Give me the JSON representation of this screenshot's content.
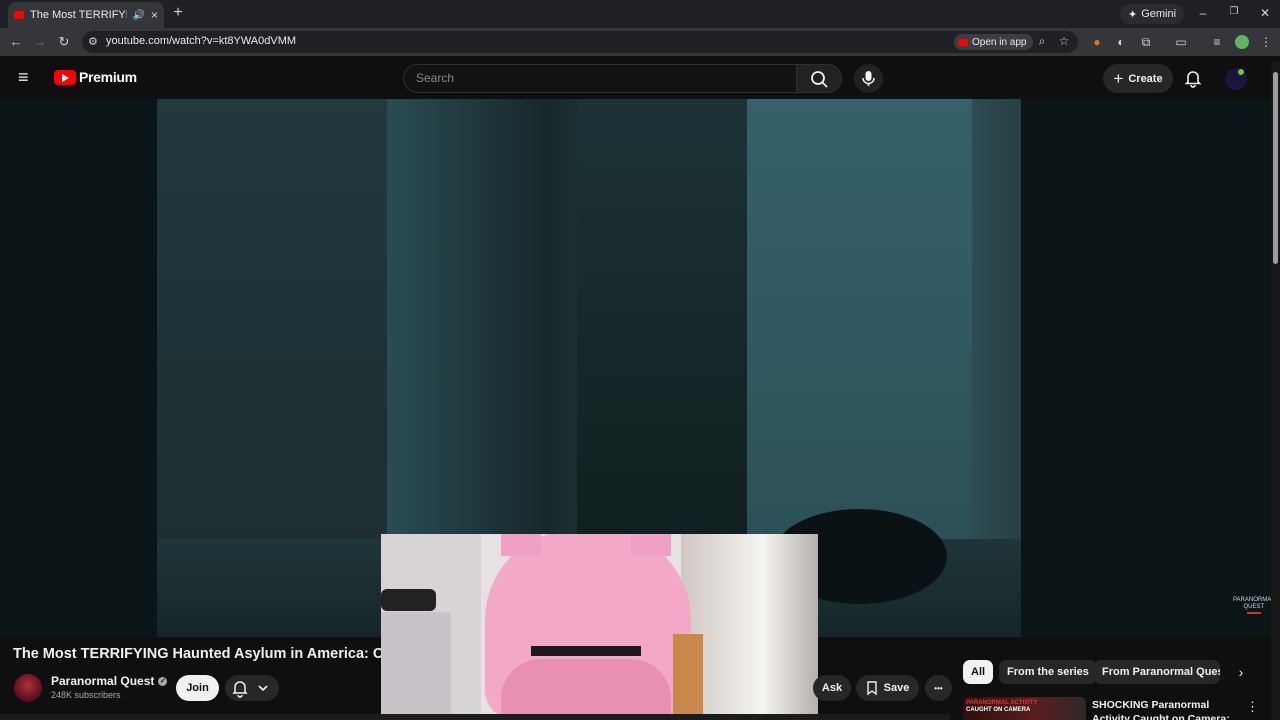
{
  "browser": {
    "tab": {
      "title": "The Most TERRIFYING Haunted Asylum in America: Chilling Paranormal Investigation",
      "audio_icon": "speaker-icon",
      "close": "×"
    },
    "new_tab": "+",
    "gemini_label": "Gemini",
    "window_controls": {
      "minimize": "–",
      "restore": "❐",
      "close": "✕"
    },
    "url": "youtube.com/watch?v=kt8YWA0dVMM",
    "open_in_app": "Open in app"
  },
  "youtube": {
    "logo_text": "Premium",
    "search_placeholder": "Search",
    "create_label": "Create"
  },
  "video": {
    "watermark": "PARANORMAL\nQUEST",
    "title": "The Most TERRIFYING Haunted Asylum in America: Chil",
    "channel": {
      "name": "Paranormal Quest",
      "subscribers": "248K subscribers"
    },
    "join_label": "Join",
    "ask_label": "Ask",
    "save_label": "Save",
    "more_label": "•••"
  },
  "chips": [
    "All",
    "From the series",
    "From Paranormal Quest"
  ],
  "recommendation": {
    "thumb_line1": "PARANORMAL ACTIVITY",
    "thumb_line2": "CAUGHT ON CAMERA",
    "title": "SHOCKING Paranormal Activity Caught on Camera: The"
  },
  "colors": {
    "brand_red": "#ff0000",
    "background": "#0f0f0f",
    "chip_active": "#f1f1f1",
    "chip_inactive": "#272727"
  }
}
